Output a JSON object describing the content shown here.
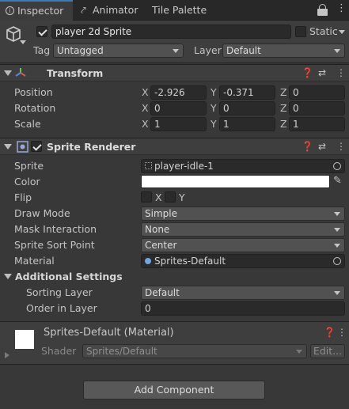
{
  "tabs": [
    {
      "label": "Inspector",
      "icon": "info-icon"
    },
    {
      "label": "Animator",
      "icon": "animator-icon"
    },
    {
      "label": "Tile Palette"
    }
  ],
  "object": {
    "name": "player 2d Sprite",
    "active": true,
    "static_label": "Static",
    "static_checked": false,
    "tag_label": "Tag",
    "tag_value": "Untagged",
    "layer_label": "Layer",
    "layer_value": "Default"
  },
  "transform": {
    "title": "Transform",
    "rows": [
      {
        "label": "Position",
        "x": "-2.926",
        "y": "-0.371",
        "z": "0"
      },
      {
        "label": "Rotation",
        "x": "0",
        "y": "0",
        "z": "0"
      },
      {
        "label": "Scale",
        "x": "1",
        "y": "1",
        "z": "1"
      }
    ],
    "axes": {
      "x": "X",
      "y": "Y",
      "z": "Z"
    }
  },
  "sprite_renderer": {
    "title": "Sprite Renderer",
    "enabled": true,
    "sprite_label": "Sprite",
    "sprite_value": "player-idle-1",
    "color_label": "Color",
    "color_value": "#ffffff",
    "flip_label": "Flip",
    "flip_x": "X",
    "flip_y": "Y",
    "draw_mode_label": "Draw Mode",
    "draw_mode_value": "Simple",
    "mask_label": "Mask Interaction",
    "mask_value": "None",
    "sort_point_label": "Sprite Sort Point",
    "sort_point_value": "Center",
    "material_label": "Material",
    "material_value": "Sprites-Default",
    "additional_title": "Additional Settings",
    "sorting_layer_label": "Sorting Layer",
    "sorting_layer_value": "Default",
    "order_label": "Order in Layer",
    "order_value": "0"
  },
  "material": {
    "title": "Sprites-Default (Material)",
    "shader_label": "Shader",
    "shader_value": "Sprites/Default",
    "edit_label": "Edit..."
  },
  "add_component_label": "Add Component",
  "colors": {
    "background": "#383838",
    "accent": "#3a79bb"
  }
}
